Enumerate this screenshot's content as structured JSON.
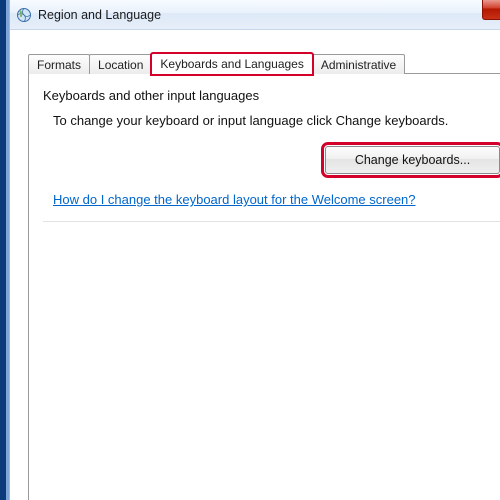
{
  "window": {
    "title": "Region and Language"
  },
  "tabs": [
    {
      "label": "Formats"
    },
    {
      "label": "Location"
    },
    {
      "label": "Keyboards and Languages"
    },
    {
      "label": "Administrative"
    }
  ],
  "panel": {
    "group_title": "Keyboards and other input languages",
    "group_desc": "To change your keyboard or input language click Change keyboards.",
    "change_button": "Change keyboards...",
    "help_link": "How do I change the keyboard layout for the Welcome screen?"
  },
  "highlight": {
    "active_tab_index": 2
  }
}
